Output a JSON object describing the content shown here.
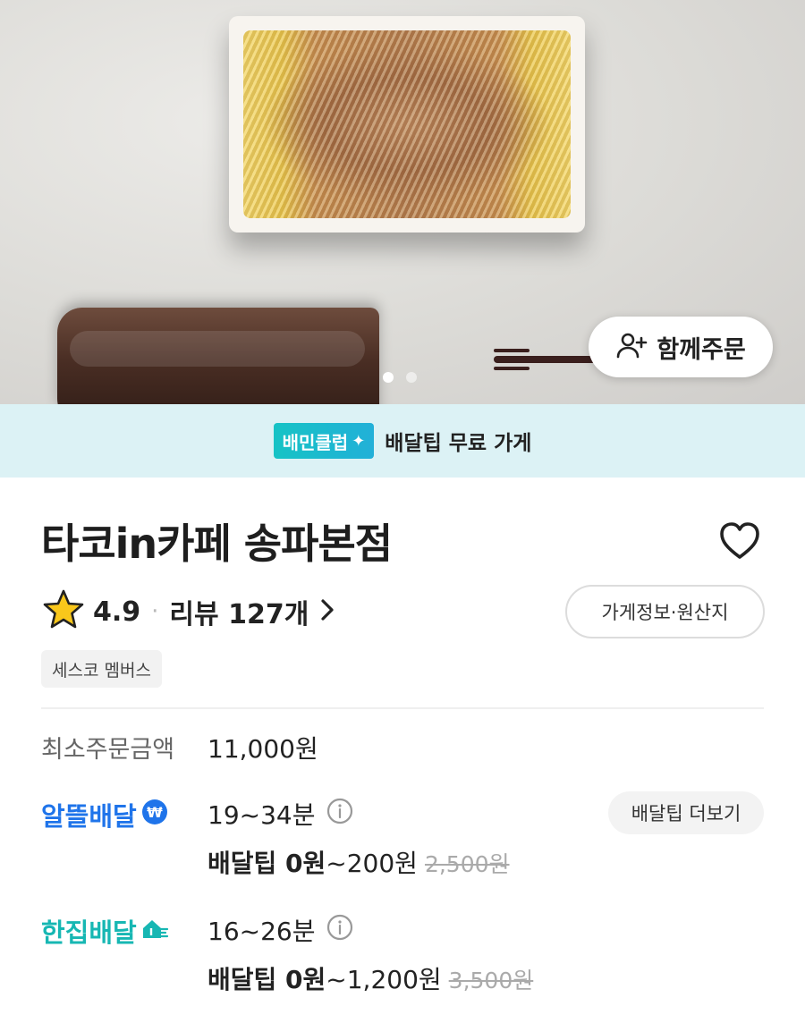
{
  "hero": {
    "group_order_label": "함께주문",
    "carousel_index": 1,
    "carousel_count": 2
  },
  "club_banner": {
    "badge_text": "배민클럽",
    "text": "배달팁 무료 가게"
  },
  "store": {
    "name": "타코in카페 송파본점",
    "rating": "4.9",
    "rating_separator": "·",
    "reviews_label": "리뷰 127개",
    "info_button": "가게정보·원산지",
    "tag": "세스코 멤버스"
  },
  "min_order": {
    "label": "최소주문금액",
    "value": "11,000원"
  },
  "delivery_options": [
    {
      "brand": "알뜰배달",
      "time": "19~34분",
      "fee_bold": "배달팁 0원",
      "fee_rest": "~200원",
      "fee_original": "2,500원",
      "more_button": "배달팁 더보기"
    },
    {
      "brand": "한집배달",
      "time": "16~26분",
      "fee_bold": "배달팁 0원",
      "fee_rest": "~1,200원",
      "fee_original": "3,500원"
    }
  ],
  "colors": {
    "club_banner_bg": "#dcf2f5",
    "albbae_blue": "#1f74ea",
    "hanjib_teal": "#17b7b3",
    "star_yellow": "#f9c71b"
  }
}
